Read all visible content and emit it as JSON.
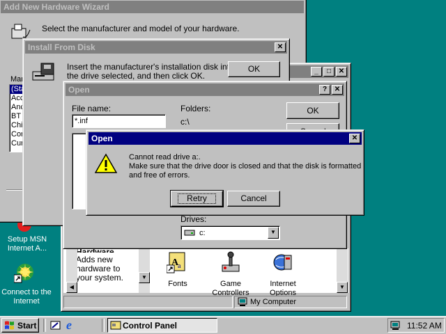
{
  "desktop": {
    "icons": [
      {
        "label": "Setup MSN Internet A...",
        "icon": "msn-icon"
      },
      {
        "label": "Connect to the Internet",
        "icon": "connect-internet-icon"
      }
    ]
  },
  "wizard": {
    "title": "Add New Hardware Wizard",
    "instruction": "Select the manufacturer and model of your hardware.",
    "list_label": "Manu",
    "list_items": [
      "(Sta",
      "Acc",
      "Anc",
      "BT",
      "Chi",
      "Cor",
      "Cur"
    ]
  },
  "install_disk": {
    "title": "Install From Disk",
    "message_line1": "Insert the manufacturer's installation disk into",
    "message_line2": "the drive selected, and then click OK.",
    "ok_label": "OK"
  },
  "control_panel": {
    "items": [
      {
        "label": "Fonts",
        "icon": "fonts-icon"
      },
      {
        "label": "Game Controllers",
        "icon": "game-controller-icon"
      },
      {
        "label": "Internet Options",
        "icon": "internet-options-icon"
      }
    ],
    "side_text": {
      "heading": "Hardware",
      "body": "Adds new hardware to your system."
    },
    "status": "My Computer"
  },
  "open_dialog": {
    "title": "Open",
    "file_name_label": "File name:",
    "file_name_value": "*.inf",
    "folders_label": "Folders:",
    "folder_path": "c:\\",
    "ok_label": "OK",
    "cancel_label": "Cancel",
    "drives_label": "Drives:",
    "drive_value": "c:"
  },
  "error_dialog": {
    "title": "Open",
    "line1": "Cannot read drive a:.",
    "line2": "Make sure that the drive door is closed and that the disk is formatted",
    "line3": "and free of errors.",
    "retry_label": "Retry",
    "cancel_label": "Cancel"
  },
  "taskbar": {
    "start_label": "Start",
    "task_label": "Control Panel",
    "clock": "11:52 AM"
  },
  "colors": {
    "desktop": "#008080",
    "titlebar_active": "#000080",
    "titlebar_inactive": "#808080",
    "face": "#c0c0c0"
  }
}
